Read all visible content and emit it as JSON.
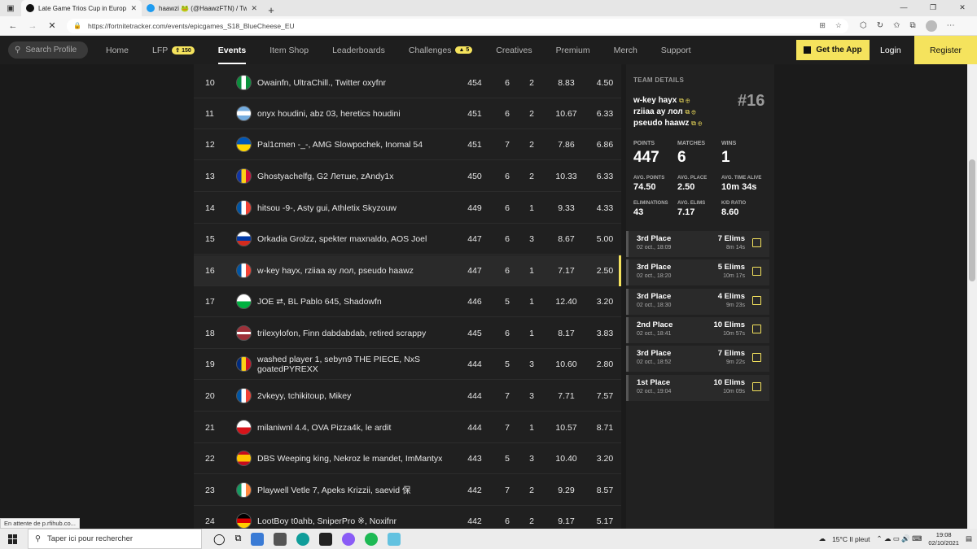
{
  "browser": {
    "tabs": [
      {
        "title": "Late Game Trios Cup in Europe: S"
      },
      {
        "title": "haawzi 🐸 (@HaawzFTN) / Twitte"
      }
    ],
    "url": "https://fortnitetracker.com/events/epicgames_S18_BlueCheese_EU",
    "status_text": "En attente de p.rfihub.co..."
  },
  "nav": {
    "search_placeholder": "Search Profile",
    "links": [
      {
        "label": "Home"
      },
      {
        "label": "LFP",
        "badge": "150"
      },
      {
        "label": "Events"
      },
      {
        "label": "Item Shop"
      },
      {
        "label": "Leaderboards"
      },
      {
        "label": "Challenges",
        "badge": "5"
      },
      {
        "label": "Creatives"
      },
      {
        "label": "Premium"
      },
      {
        "label": "Merch"
      },
      {
        "label": "Support"
      }
    ],
    "get_app": "Get the App",
    "login": "Login",
    "register": "Register"
  },
  "leaderboard": {
    "rows": [
      {
        "rank": "10",
        "names": "Owainfn, UltraChill., Twitter oxyfnr",
        "points": "454",
        "matches": "6",
        "wins": "2",
        "avg_elims": "8.83",
        "avg_place": "4.50",
        "flag": "ng"
      },
      {
        "rank": "11",
        "names": "onyx houdini, abz 03, heretics houdini",
        "points": "451",
        "matches": "6",
        "wins": "2",
        "avg_elims": "10.67",
        "avg_place": "6.33",
        "flag": "ar"
      },
      {
        "rank": "12",
        "names": "Pal1cmen -_-, AMG Slowpochek, Inomal 54",
        "points": "451",
        "matches": "7",
        "wins": "2",
        "avg_elims": "7.86",
        "avg_place": "6.86",
        "flag": "ua"
      },
      {
        "rank": "13",
        "names": "Ghostyachelfg, G2 Летше, zAndy1x",
        "points": "450",
        "matches": "6",
        "wins": "2",
        "avg_elims": "10.33",
        "avg_place": "6.33",
        "flag": "ad"
      },
      {
        "rank": "14",
        "names": "hitsou -9-, Asty gui, Athletix Skyzouw",
        "points": "449",
        "matches": "6",
        "wins": "1",
        "avg_elims": "9.33",
        "avg_place": "4.33",
        "flag": "fr"
      },
      {
        "rank": "15",
        "names": "Orkadia Grolzz, spekter maxnaldo, AOS Joel",
        "points": "447",
        "matches": "6",
        "wins": "3",
        "avg_elims": "8.67",
        "avg_place": "5.00",
        "flag": "ru"
      },
      {
        "rank": "16",
        "names": "w-key hayx, rziiaa ay лол, pseudo haawz",
        "points": "447",
        "matches": "6",
        "wins": "1",
        "avg_elims": "7.17",
        "avg_place": "2.50",
        "flag": "fr",
        "highlight": true
      },
      {
        "rank": "17",
        "names": "JOE ⮂, BL Pablo 645, Shadowfn",
        "points": "446",
        "matches": "5",
        "wins": "1",
        "avg_elims": "12.40",
        "avg_place": "3.20",
        "flag": "wa"
      },
      {
        "rank": "18",
        "names": "trilexylofon, Finn dabdabdab, retired scrappy",
        "points": "445",
        "matches": "6",
        "wins": "1",
        "avg_elims": "8.17",
        "avg_place": "3.83",
        "flag": "lv"
      },
      {
        "rank": "19",
        "names": "washed player 1, sebyn9 THE PIECE, NxS goatedPYREXX",
        "points": "444",
        "matches": "5",
        "wins": "3",
        "avg_elims": "10.60",
        "avg_place": "2.80",
        "flag": "ro"
      },
      {
        "rank": "20",
        "names": "2vkeyy, tchikitoup, Mikey",
        "points": "444",
        "matches": "7",
        "wins": "3",
        "avg_elims": "7.71",
        "avg_place": "7.57",
        "flag": "fr"
      },
      {
        "rank": "21",
        "names": "milaniwnl 4.4, OVA Pizza4k, le ardit",
        "points": "444",
        "matches": "7",
        "wins": "1",
        "avg_elims": "10.57",
        "avg_place": "8.71",
        "flag": "cz"
      },
      {
        "rank": "22",
        "names": "DBS Weeping king, Nekroz le mandet, ImMantyx",
        "points": "443",
        "matches": "5",
        "wins": "3",
        "avg_elims": "10.40",
        "avg_place": "3.20",
        "flag": "es"
      },
      {
        "rank": "23",
        "names": "Playwell Vetle 7, Apeks Krizzii, saevid 保",
        "points": "442",
        "matches": "7",
        "wins": "2",
        "avg_elims": "9.29",
        "avg_place": "8.57",
        "flag": "ie"
      },
      {
        "rank": "24",
        "names": "LootBoy t0ahb, SniperPro ※, Noxifnr",
        "points": "442",
        "matches": "6",
        "wins": "2",
        "avg_elims": "9.17",
        "avg_place": "5.17",
        "flag": "de"
      }
    ]
  },
  "team": {
    "header": "TEAM DETAILS",
    "members": [
      "w-key hayx",
      "rziiaa ay лол",
      "pseudo haawz"
    ],
    "place": "#16",
    "stats": {
      "points_label": "POINTS",
      "points": "447",
      "matches_label": "MATCHES",
      "matches": "6",
      "wins_label": "WINS",
      "wins": "1",
      "avg_points_label": "AVG. POINTS",
      "avg_points": "74.50",
      "avg_place_label": "AVG. PLACE",
      "avg_place": "2.50",
      "avg_time_label": "AVG. TIME ALIVE",
      "avg_time": "10m 34s",
      "elims_label": "ELIMINATIONS",
      "elims": "43",
      "avg_elims_label": "AVG. ELIMS",
      "avg_elims": "7.17",
      "kd_label": "K/D RATIO",
      "kd": "8.60"
    },
    "matches": [
      {
        "place": "3rd Place",
        "date": "02 oct., 18:09",
        "elims": "7 Elims",
        "time": "8m 14s"
      },
      {
        "place": "3rd Place",
        "date": "02 oct., 18:20",
        "elims": "5 Elims",
        "time": "10m 17s"
      },
      {
        "place": "3rd Place",
        "date": "02 oct., 18:30",
        "elims": "4 Elims",
        "time": "9m 23s"
      },
      {
        "place": "2nd Place",
        "date": "02 oct., 18:41",
        "elims": "10 Elims",
        "time": "10m 57s"
      },
      {
        "place": "3rd Place",
        "date": "02 oct., 18:52",
        "elims": "7 Elims",
        "time": "9m 22s"
      },
      {
        "place": "1st Place",
        "date": "02 oct., 19:04",
        "elims": "10 Elims",
        "time": "10m 09s"
      }
    ]
  },
  "taskbar": {
    "search_placeholder": "Taper ici pour rechercher",
    "weather": "15°C  Il pleut",
    "time": "19:08",
    "date": "02/10/2021"
  },
  "colors": {
    "accent": "#f5e35d",
    "bg": "#1c1c1c"
  }
}
